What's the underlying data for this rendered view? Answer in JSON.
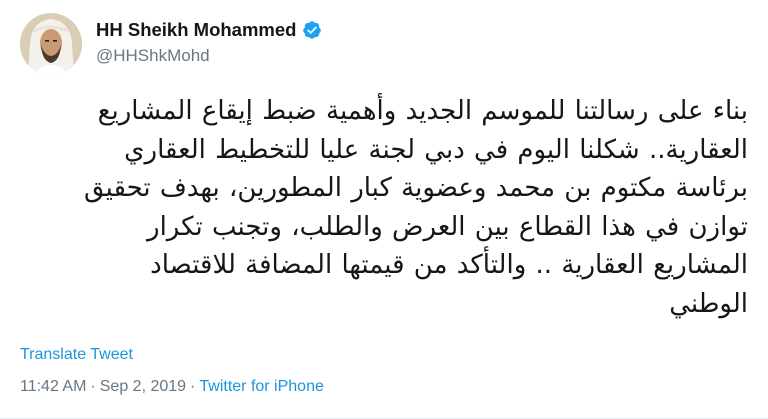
{
  "tweet": {
    "author": {
      "display_name": "HH Sheikh Mohammed",
      "handle": "@HHShkMohd",
      "verified": true,
      "avatar_icon": "profile-photo"
    },
    "text": "بناء على رسالتنا للموسم الجديد وأهمية ضبط إيقاع المشاريع العقارية.. شكلنا اليوم في دبي لجنة عليا للتخطيط العقاري برئاسة مكتوم بن محمد وعضوية كبار المطورين، بهدف تحقيق توازن في هذا القطاع بين العرض والطلب، وتجنب تكرار المشاريع العقارية .. والتأكد من قيمتها المضافة للاقتصاد الوطني",
    "translate_label": "Translate Tweet",
    "time": "11:42 AM",
    "separator": "·",
    "date": "Sep 2, 2019",
    "source": "Twitter for iPhone"
  },
  "colors": {
    "link": "#1b95e0",
    "muted": "#657786",
    "text": "#14171a",
    "verified": "#1da1f2"
  }
}
